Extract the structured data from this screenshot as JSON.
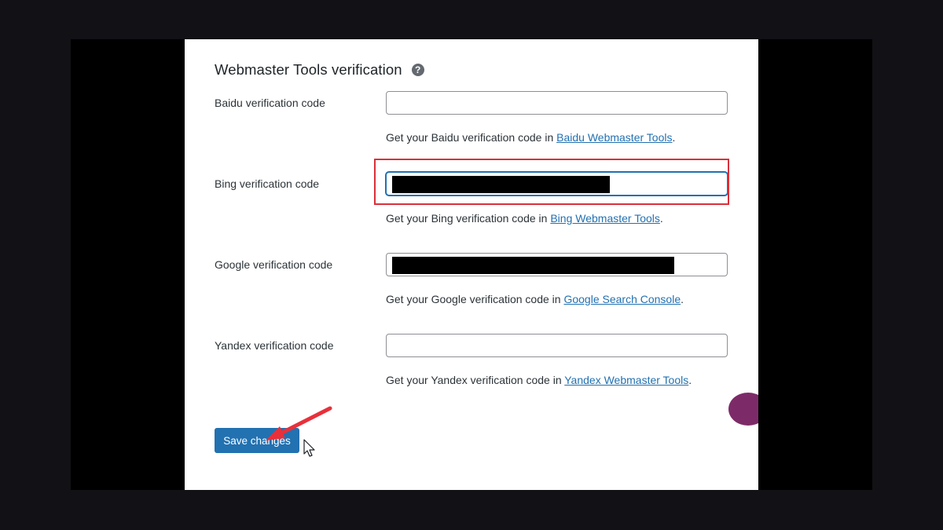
{
  "section": {
    "title": "Webmaster Tools verification",
    "help_icon": "question-mark-icon"
  },
  "fields": [
    {
      "label": "Baidu verification code",
      "value": "",
      "help_prefix": "Get your Baidu verification code in ",
      "link_text": "Baidu Webmaster Tools",
      "help_suffix": "."
    },
    {
      "label": "Bing verification code",
      "value": "",
      "help_prefix": "Get your Bing verification code in ",
      "link_text": "Bing Webmaster Tools",
      "help_suffix": "."
    },
    {
      "label": "Google verification code",
      "value": "",
      "help_prefix": "Get your Google verification code in ",
      "link_text": "Google Search Console",
      "help_suffix": "."
    },
    {
      "label": "Yandex verification code",
      "value": "",
      "help_prefix": "Get your Yandex verification code in ",
      "link_text": "Yandex Webmaster Tools",
      "help_suffix": "."
    }
  ],
  "actions": {
    "save_label": "Save changes"
  },
  "colors": {
    "accent": "#2271b1",
    "highlight": "#d9303a",
    "arrow": "#e8303a"
  }
}
